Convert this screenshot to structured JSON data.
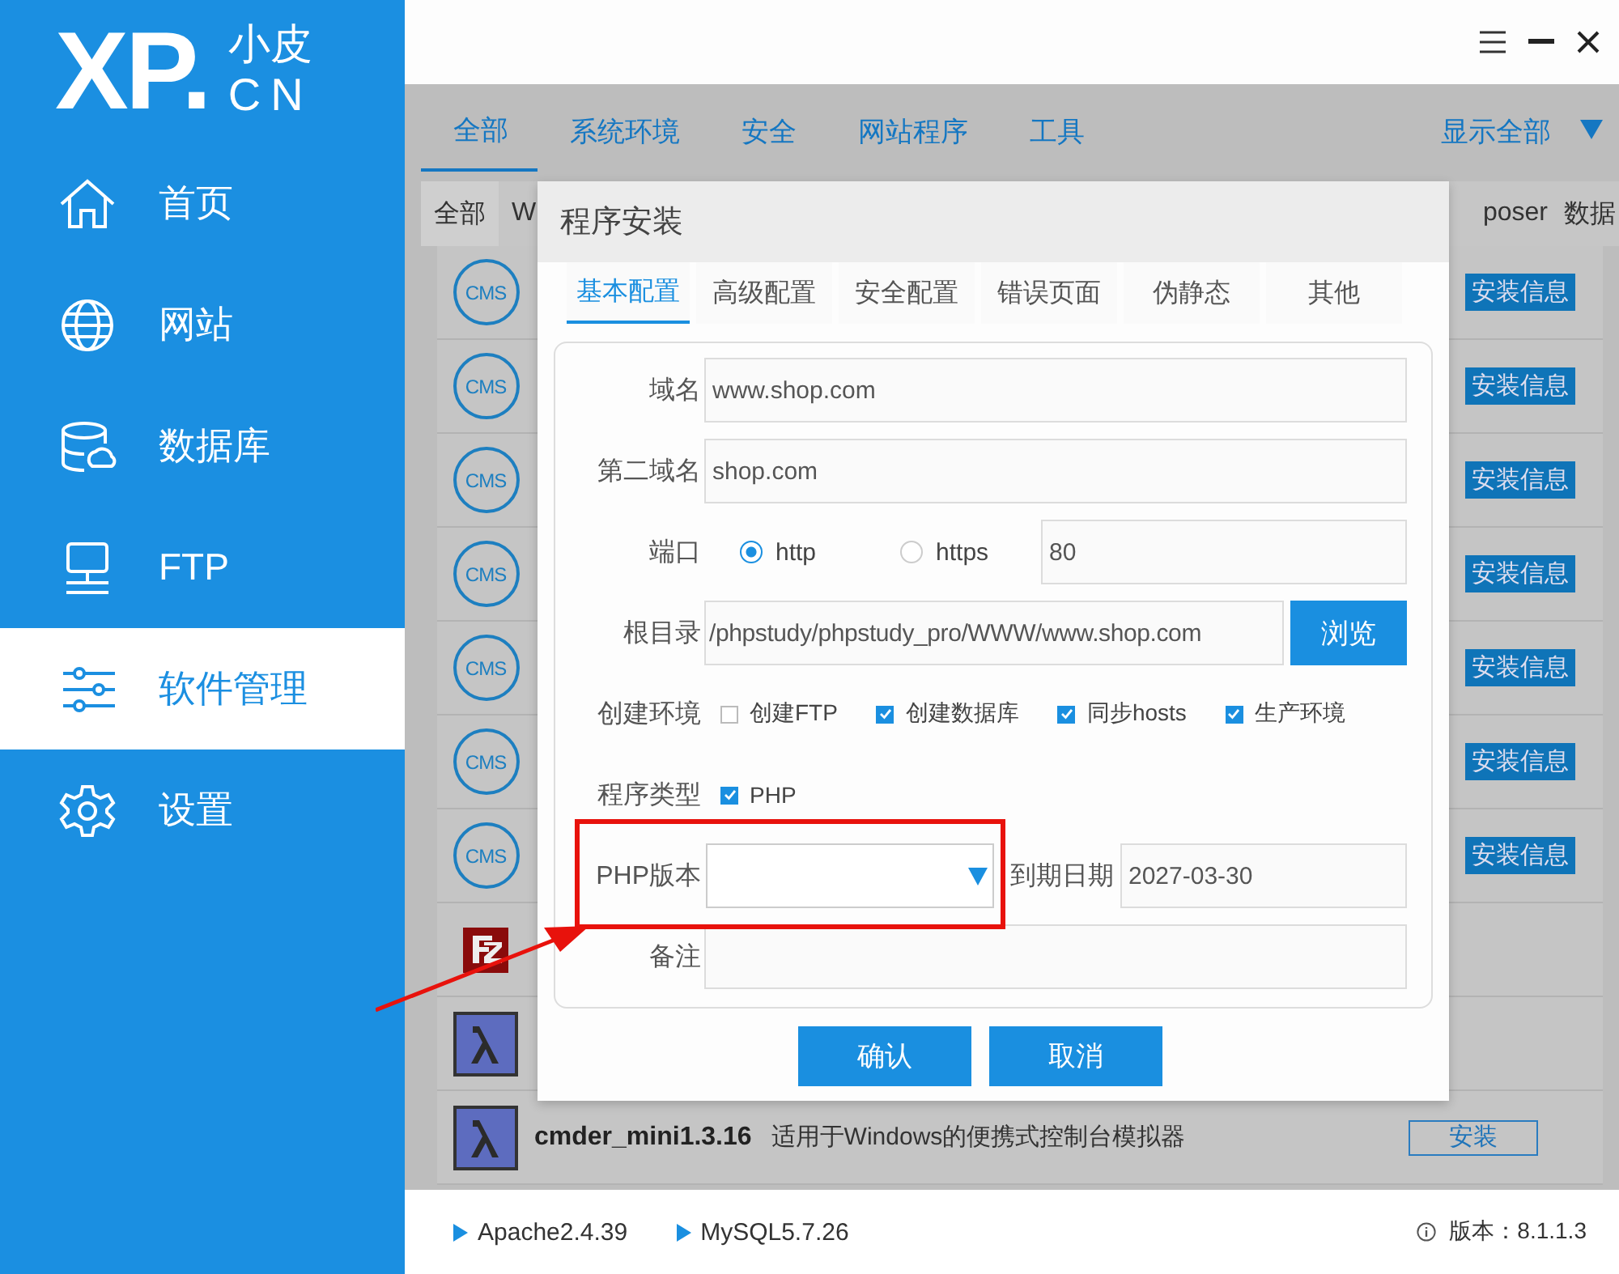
{
  "sidebar": {
    "logo": {
      "mark": "XP.",
      "name": "小皮",
      "domain": "CN"
    },
    "items": [
      {
        "kind": "home",
        "label": "首页",
        "selected": false
      },
      {
        "kind": "globe",
        "label": "网站",
        "selected": false
      },
      {
        "kind": "database",
        "label": "数据库",
        "selected": false
      },
      {
        "kind": "monitor",
        "label": "FTP",
        "selected": false
      },
      {
        "kind": "sliders",
        "label": "软件管理",
        "selected": true
      },
      {
        "kind": "gear",
        "label": "设置",
        "selected": false
      }
    ]
  },
  "categories": {
    "tabs": [
      {
        "label": "全部",
        "selected": true
      },
      {
        "label": "系统环境",
        "selected": false
      },
      {
        "label": "安全",
        "selected": false
      },
      {
        "label": "网站程序",
        "selected": false
      },
      {
        "label": "工具",
        "selected": false
      }
    ],
    "show_all": "显示全部"
  },
  "filters": {
    "left": [
      {
        "label": "全部",
        "selected": true
      },
      {
        "label": "W",
        "selected": false
      }
    ],
    "right": [
      {
        "label": "poser",
        "selected": false
      },
      {
        "label": "数据",
        "selected": false
      }
    ]
  },
  "software": [
    {
      "kind": "cms",
      "badge": "CMS",
      "action": "安装信息"
    },
    {
      "kind": "cms",
      "badge": "CMS",
      "action": "安装信息"
    },
    {
      "kind": "cms",
      "badge": "CMS",
      "action": "安装信息"
    },
    {
      "kind": "cms",
      "badge": "CMS",
      "action": "安装信息"
    },
    {
      "kind": "cms",
      "badge": "CMS",
      "action": "安装信息"
    },
    {
      "kind": "cms",
      "badge": "CMS",
      "action": "安装信息"
    },
    {
      "kind": "cms",
      "badge": "CMS",
      "action": "安装信息"
    },
    {
      "kind": "filezilla"
    },
    {
      "kind": "lambda"
    },
    {
      "kind": "lambda",
      "name": "cmder_mini1.3.16",
      "description": "适用于Windows的便携式控制台模拟器",
      "action": "安装"
    }
  ],
  "footer": {
    "services": [
      "Apache2.4.39",
      "MySQL5.7.26"
    ],
    "version": "版本：8.1.1.3"
  },
  "dialog": {
    "title": "程序安装",
    "tabs": [
      {
        "label": "基本配置",
        "selected": true
      },
      {
        "label": "高级配置",
        "selected": false
      },
      {
        "label": "安全配置",
        "selected": false
      },
      {
        "label": "错误页面",
        "selected": false
      },
      {
        "label": "伪静态",
        "selected": false
      },
      {
        "label": "其他",
        "selected": false
      }
    ],
    "domain": {
      "label": "域名",
      "value": "www.shop.com"
    },
    "second_domain": {
      "label": "第二域名",
      "value": "shop.com"
    },
    "port": {
      "label": "端口",
      "options": [
        {
          "label": "http",
          "selected": true
        },
        {
          "label": "https",
          "selected": false
        }
      ],
      "value": "80"
    },
    "root": {
      "label": "根目录",
      "value": "/phpstudy/phpstudy_pro/WWW/www.shop.com",
      "button": "浏览"
    },
    "environment": {
      "label": "创建环境",
      "options": [
        {
          "label": "创建FTP",
          "checked": false
        },
        {
          "label": "创建数据库",
          "checked": true
        },
        {
          "label": "同步hosts",
          "checked": true
        },
        {
          "label": "生产环境",
          "checked": true
        }
      ]
    },
    "program_type": {
      "label": "程序类型",
      "options": [
        {
          "label": "PHP",
          "checked": true
        }
      ]
    },
    "php_version": {
      "label": "PHP版本",
      "highlighted": true
    },
    "expiry": {
      "label": "到期日期",
      "value": "2027-03-30"
    },
    "note": {
      "label": "备注"
    },
    "buttons": [
      "确认",
      "取消"
    ]
  }
}
